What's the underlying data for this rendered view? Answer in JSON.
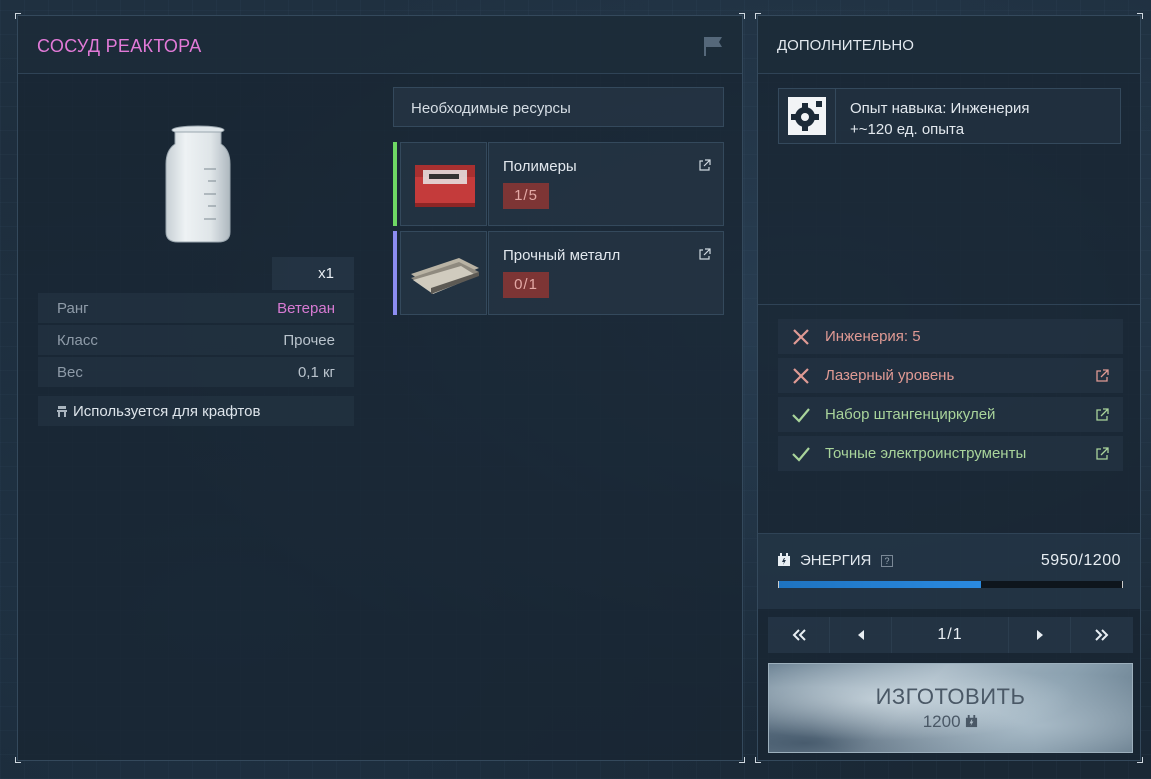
{
  "item": {
    "title": "СОСУД РЕАКТОРА",
    "quantity": "x1",
    "properties": [
      {
        "key": "Ранг",
        "value": "Ветеран"
      },
      {
        "key": "Класс",
        "value": "Прочее"
      },
      {
        "key": "Вес",
        "value": "0,1 кг"
      }
    ],
    "used_for": "Используется для крафтов"
  },
  "resources": {
    "header": "Необходимые ресурсы",
    "items": [
      {
        "name": "Полимеры",
        "count": "1/5",
        "color": "#6fd864"
      },
      {
        "name": "Прочный металл",
        "count": "0/1",
        "color": "#8c8cf0"
      }
    ]
  },
  "extra": {
    "header": "ДОПОЛНИТЕЛЬНО",
    "skill_line1": "Опыт навыка: Инженерия",
    "skill_line2": "+~120 ед. опыта",
    "requirements": [
      {
        "label": "Инженерия: 5",
        "met": false,
        "link": false
      },
      {
        "label": "Лазерный уровень",
        "met": false,
        "link": true
      },
      {
        "label": "Набор штангенциркулей",
        "met": true,
        "link": true
      },
      {
        "label": "Точные электроинструменты",
        "met": true,
        "link": true
      }
    ]
  },
  "energy": {
    "label": "ЭНЕРГИЯ",
    "help": "?",
    "value": "5950/1200",
    "fill_percent": 59
  },
  "pager": {
    "page": "1/1"
  },
  "craft": {
    "label": "ИЗГОТОВИТЬ",
    "cost": "1200"
  },
  "colors": {
    "title": "#e27ad8",
    "fail": "#e09a94",
    "ok": "#a9d49b",
    "energy": "#1e73c0"
  }
}
